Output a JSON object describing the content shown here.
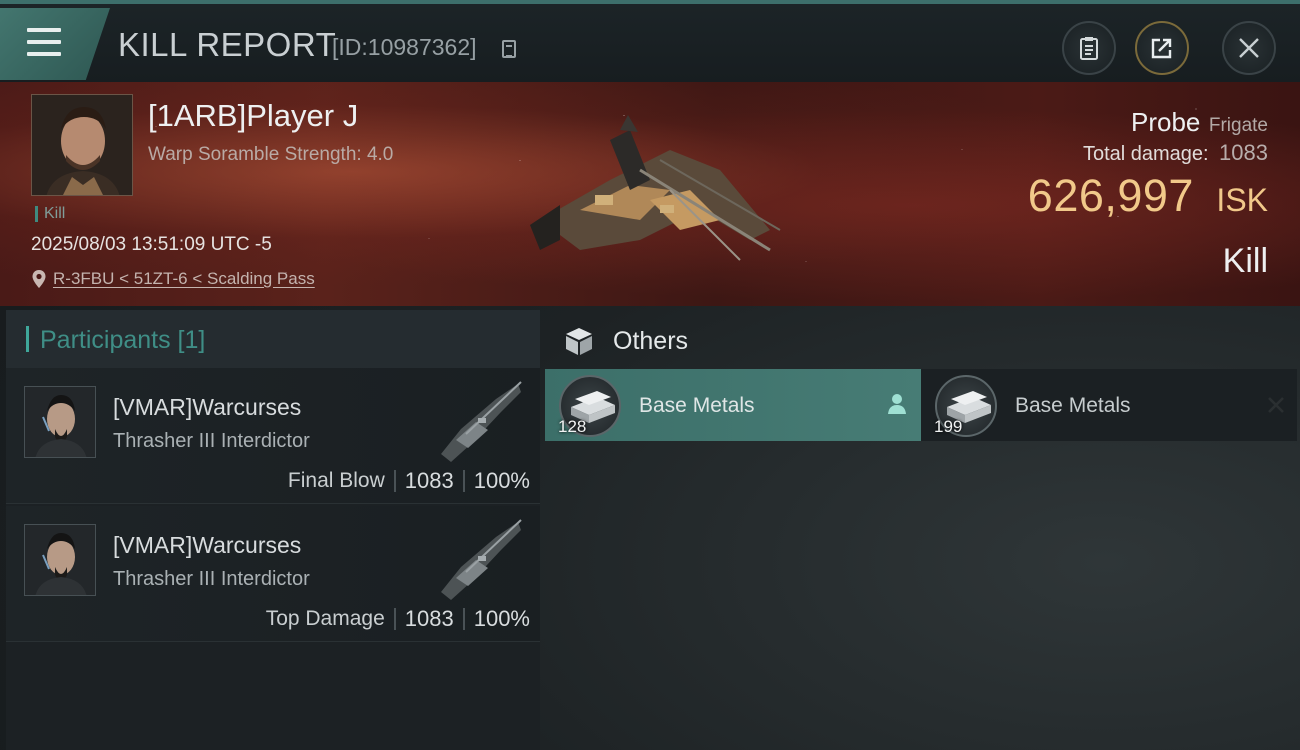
{
  "header": {
    "title": "KILL REPORT",
    "report_id": "[ID:10987362]"
  },
  "victim": {
    "name": "[1ARB]Player J",
    "subtitle": "Warp Soramble Strength: 4.0",
    "tag": "Kill",
    "timestamp": "2025/08/03 13:51:09 UTC -5",
    "location": "R-3FBU < 51ZT-6 < Scalding Pass"
  },
  "ship": {
    "name": "Probe",
    "class": "Frigate",
    "total_damage_label": "Total damage:",
    "total_damage": "1083",
    "isk_value": "626,997",
    "isk_unit": "ISK",
    "result": "Kill"
  },
  "participants": {
    "header": "Participants [1]",
    "rows": [
      {
        "name": "[VMAR]Warcurses",
        "ship": "Thrasher III Interdictor",
        "role": "Final Blow",
        "damage": "1083",
        "percent": "100%"
      },
      {
        "name": "[VMAR]Warcurses",
        "ship": "Thrasher III Interdictor",
        "role": "Top Damage",
        "damage": "1083",
        "percent": "100%"
      }
    ]
  },
  "others": {
    "title": "Others",
    "items": [
      {
        "name": "Base Metals",
        "quantity": "128",
        "selected": true
      },
      {
        "name": "Base Metals",
        "quantity": "199",
        "selected": false
      }
    ]
  },
  "colors": {
    "accent_teal": "#3f8e86",
    "isk_gold": "#f1c98a",
    "banner_red": "#4a1a17"
  },
  "icons": [
    "menu-icon",
    "copy-icon",
    "clipboard-icon",
    "share-icon",
    "close-icon",
    "location-pin-icon",
    "cube-icon",
    "person-icon",
    "remove-icon"
  ]
}
